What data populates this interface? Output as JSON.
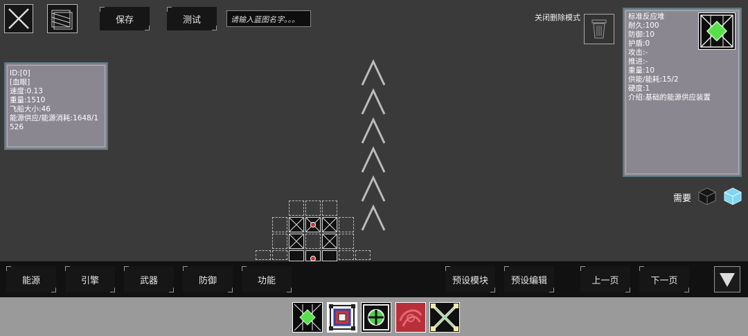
{
  "toolbar": {
    "save_label": "保存",
    "test_label": "测试",
    "name_placeholder": "请输入蓝图名字。。。",
    "delete_mode_label": "关闭删除模式"
  },
  "ship_info": {
    "lines": [
      "ID:[0]",
      "[血眼]",
      "速度:0.13",
      "重量:1510",
      "飞船大小:46",
      "能源供应/能源消耗:1648/1526"
    ]
  },
  "module_info": {
    "lines": [
      "标准反应堆",
      "耐久:100",
      "防御:10",
      "护盾:0",
      "攻击:-",
      "推进:-",
      "重量:10",
      "供能/能耗:15/2",
      "硬度:1",
      "介绍:基础的能源供应装置"
    ]
  },
  "requirement": {
    "label": "需要"
  },
  "categories": [
    "能源",
    "引擎",
    "武器",
    "防御",
    "功能"
  ],
  "actions": {
    "preset_module": "预设模块",
    "preset_edit": "预设编辑",
    "prev_page": "上一页",
    "next_page": "下一页"
  },
  "tray": {
    "modules": [
      "reactor-module-icon",
      "armor-module-icon",
      "shield-module-icon",
      "red-core-module-icon",
      "cross-module-icon"
    ]
  },
  "colors": {
    "background": "#3a3a3a",
    "panel": "#8b8791",
    "accent_green": "#57e04a",
    "tray": "#9a9a9a"
  }
}
